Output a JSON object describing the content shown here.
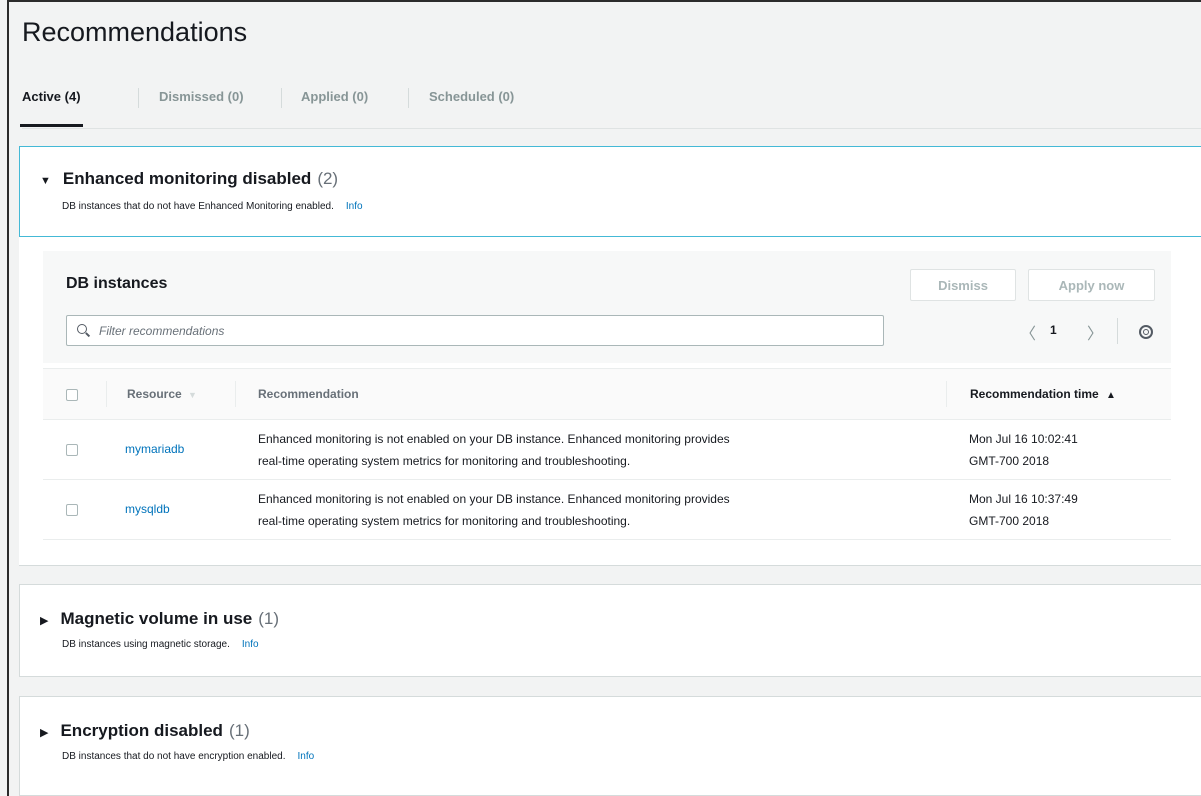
{
  "page": {
    "title": "Recommendations"
  },
  "tabs": [
    {
      "label": "Active (4)",
      "active": true
    },
    {
      "label": "Dismissed (0)",
      "active": false
    },
    {
      "label": "Applied (0)",
      "active": false
    },
    {
      "label": "Scheduled (0)",
      "active": false
    }
  ],
  "groups": [
    {
      "name": "Enhanced monitoring disabled",
      "count": "(2)",
      "description": "DB instances that do not have Enhanced Monitoring enabled.",
      "info": "Info",
      "expanded": true
    },
    {
      "name": "Magnetic volume in use",
      "count": "(1)",
      "description": "DB instances using magnetic storage.",
      "info": "Info",
      "expanded": false
    },
    {
      "name": "Encryption disabled",
      "count": "(1)",
      "description": "DB instances that do not have encryption enabled.",
      "info": "Info",
      "expanded": false
    }
  ],
  "db_instances": {
    "title": "DB instances",
    "dismiss_label": "Dismiss",
    "apply_label": "Apply now",
    "filter_placeholder": "Filter recommendations",
    "page_number": "1",
    "columns": {
      "resource": "Resource",
      "recommendation": "Recommendation",
      "time": "Recommendation time"
    },
    "rows": [
      {
        "resource": "mymariadb",
        "recommendation_line1": "Enhanced monitoring is not enabled on your DB instance. Enhanced monitoring provides",
        "recommendation_line2": "real-time operating system metrics for monitoring and troubleshooting.",
        "time_line1": "Mon Jul 16 10:02:41",
        "time_line2": "GMT-700 2018"
      },
      {
        "resource": "mysqldb",
        "recommendation_line1": "Enhanced monitoring is not enabled on your DB instance. Enhanced monitoring provides",
        "recommendation_line2": "real-time operating system metrics for monitoring and troubleshooting.",
        "time_line1": "Mon Jul 16 10:37:49",
        "time_line2": "GMT-700 2018"
      }
    ]
  },
  "icons": {
    "caret_down": "▼",
    "caret_right": "▶",
    "chevron_left": "〈",
    "chevron_right": "〉",
    "sort_down": "▼",
    "sort_up": "▲"
  },
  "colors": {
    "link": "#0073bb",
    "selected_border": "#44b9d6",
    "muted": "#879596"
  }
}
